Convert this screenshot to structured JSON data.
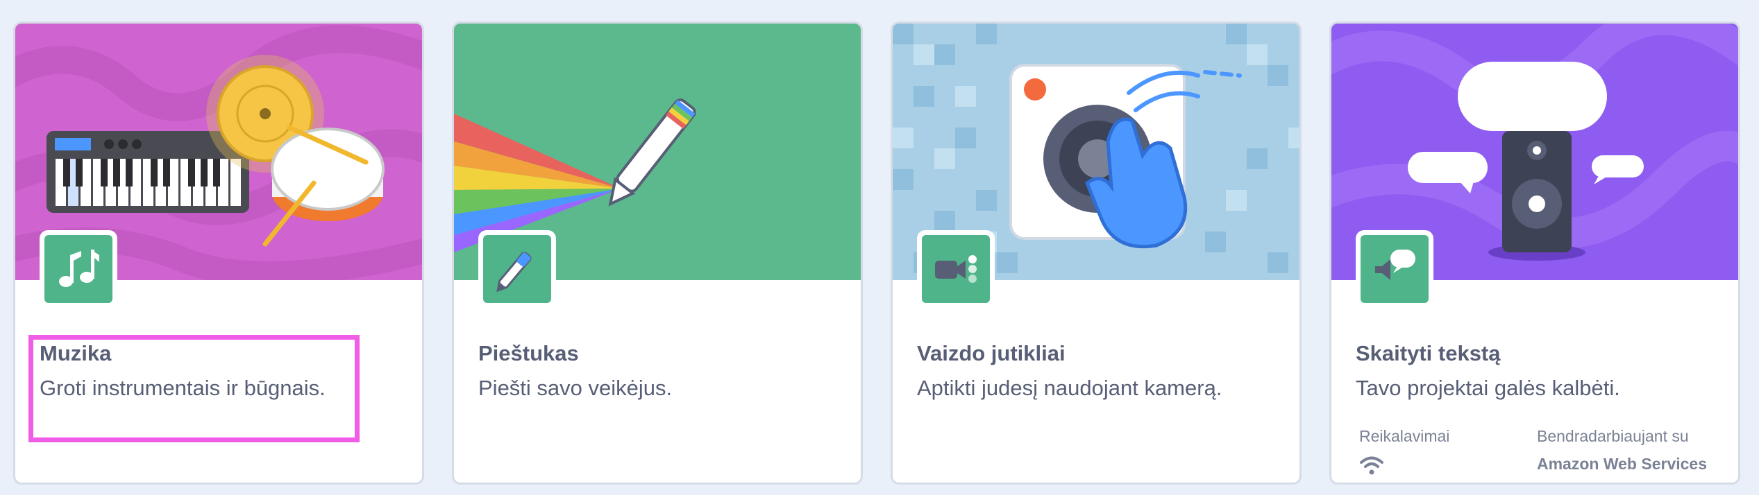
{
  "cards": [
    {
      "id": "music",
      "title": "Muzika",
      "description": "Groti instrumentais ir būgnais.",
      "icon": "music-notes-icon",
      "banner_color": "#cf63cf",
      "selected": true
    },
    {
      "id": "pen",
      "title": "Pieštukas",
      "description": "Piešti savo veikėjus.",
      "icon": "pen-icon",
      "banner_color": "#5cb98d"
    },
    {
      "id": "video",
      "title": "Vaizdo jutikliai",
      "description": "Aptikti judesį naudojant kamerą.",
      "icon": "video-camera-icon",
      "banner_color": "#a8cfe6"
    },
    {
      "id": "text2speech",
      "title": "Skaityti tekstą",
      "description": "Tavo projektai galės kalbėti.",
      "icon": "speech-speaker-icon",
      "banner_color": "#8e5cf0",
      "requirements_label": "Reikalavimai",
      "requirements_icon": "wifi-icon",
      "partner_label": "Bendradarbiaujant su",
      "partner_value": "Amazon Web Services"
    }
  ],
  "colors": {
    "icon_tile": "#4fb48a",
    "selection_outline": "#f05ee8",
    "text": "#575e75",
    "page_background": "#e9f0f9"
  }
}
